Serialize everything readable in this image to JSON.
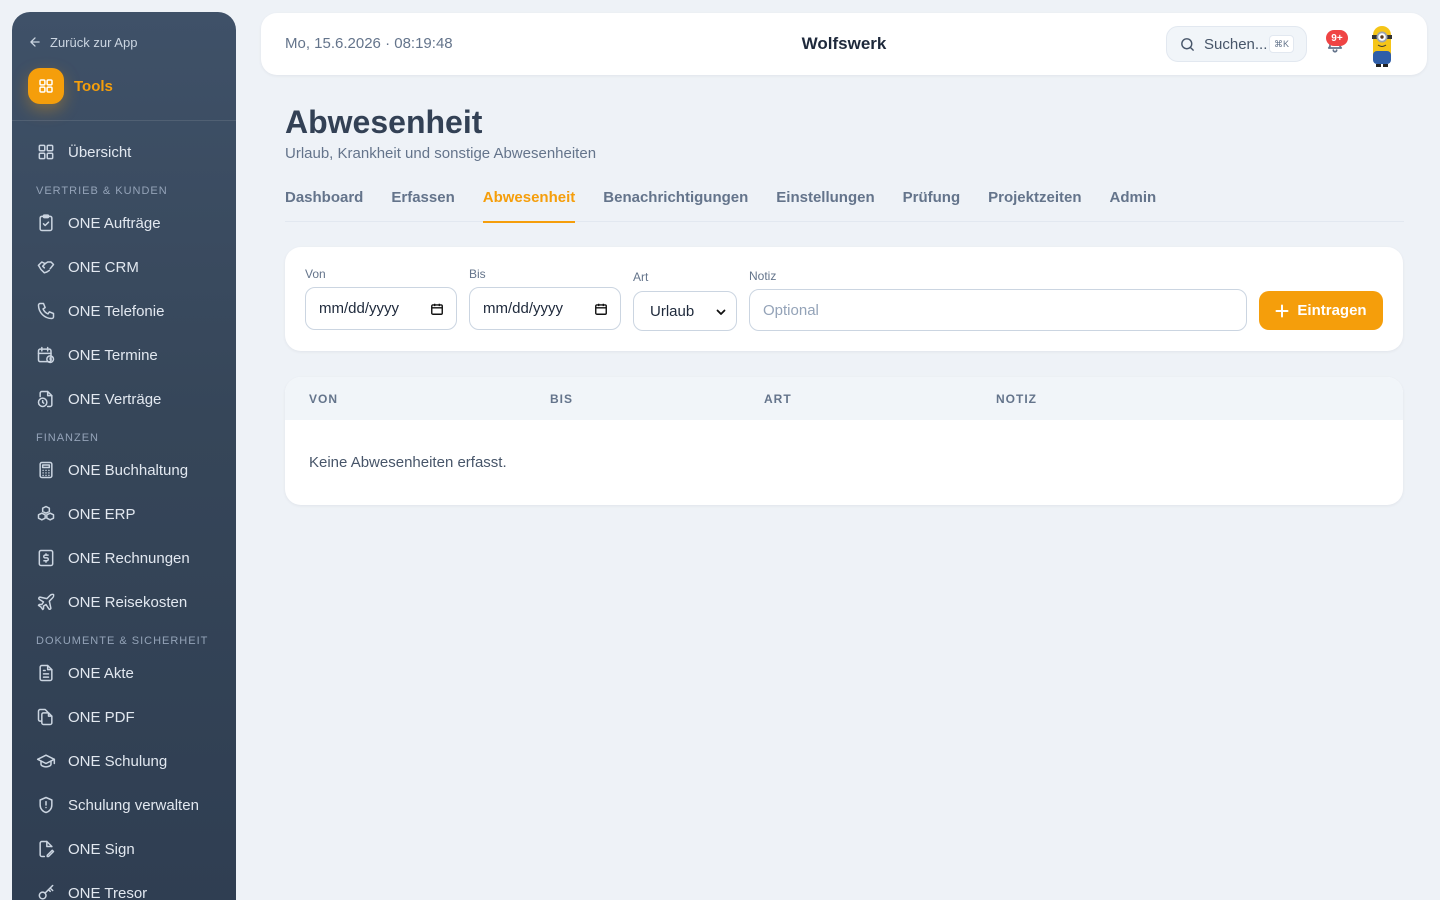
{
  "sidebar": {
    "back_label": "Zurück zur App",
    "tools_label": "Tools",
    "items": [
      {
        "type": "item",
        "label": "Übersicht",
        "icon": "grid-icon"
      },
      {
        "type": "section",
        "label": "VERTRIEB & KUNDEN"
      },
      {
        "type": "item",
        "label": "ONE Aufträge",
        "icon": "clipboard-check-icon"
      },
      {
        "type": "item",
        "label": "ONE CRM",
        "icon": "handshake-icon"
      },
      {
        "type": "item",
        "label": "ONE Telefonie",
        "icon": "phone-icon"
      },
      {
        "type": "item",
        "label": "ONE Termine",
        "icon": "calendar-clock-icon"
      },
      {
        "type": "item",
        "label": "ONE Verträge",
        "icon": "file-clock-icon"
      },
      {
        "type": "section",
        "label": "FINANZEN"
      },
      {
        "type": "item",
        "label": "ONE Buchhaltung",
        "icon": "calculator-icon"
      },
      {
        "type": "item",
        "label": "ONE ERP",
        "icon": "boxes-icon"
      },
      {
        "type": "item",
        "label": "ONE Rechnungen",
        "icon": "receipt-dollar-icon"
      },
      {
        "type": "item",
        "label": "ONE Reisekosten",
        "icon": "plane-icon"
      },
      {
        "type": "section",
        "label": "DOKUMENTE & SICHERHEIT"
      },
      {
        "type": "item",
        "label": "ONE Akte",
        "icon": "file-text-icon"
      },
      {
        "type": "item",
        "label": "ONE PDF",
        "icon": "files-icon"
      },
      {
        "type": "item",
        "label": "ONE Schulung",
        "icon": "graduation-cap-icon"
      },
      {
        "type": "item",
        "label": "Schulung verwalten",
        "icon": "shield-icon"
      },
      {
        "type": "item",
        "label": "ONE Sign",
        "icon": "file-pen-icon"
      },
      {
        "type": "item",
        "label": "ONE Tresor",
        "icon": "key-icon"
      }
    ]
  },
  "header": {
    "datetime": "Mo, 15.6.2026 · 08:19:48",
    "brand": "Wolfswerk",
    "search_label": "Suchen...",
    "search_shortcut": "⌘K",
    "notification_count": "9+"
  },
  "page": {
    "title": "Abwesenheit",
    "subtitle": "Urlaub, Krankheit und sonstige Abwesenheiten"
  },
  "tabs": [
    {
      "label": "Dashboard",
      "active": false
    },
    {
      "label": "Erfassen",
      "active": false
    },
    {
      "label": "Abwesenheit",
      "active": true
    },
    {
      "label": "Benachrichtigungen",
      "active": false
    },
    {
      "label": "Einstellungen",
      "active": false
    },
    {
      "label": "Prüfung",
      "active": false
    },
    {
      "label": "Projektzeiten",
      "active": false
    },
    {
      "label": "Admin",
      "active": false
    }
  ],
  "form": {
    "from_label": "Von",
    "from_value": "mm/dd/yyyy",
    "to_label": "Bis",
    "to_value": "mm/dd/yyyy",
    "type_label": "Art",
    "type_value": "Urlaub",
    "note_label": "Notiz",
    "note_placeholder": "Optional",
    "note_value": "",
    "submit_label": "Eintragen"
  },
  "table": {
    "columns": [
      "VON",
      "BIS",
      "ART",
      "NOTIZ"
    ],
    "empty_text": "Keine Abwesenheiten erfasst."
  },
  "colors": {
    "accent": "#f59e0b",
    "sidebar": "#364659",
    "badge": "#ef4444"
  }
}
